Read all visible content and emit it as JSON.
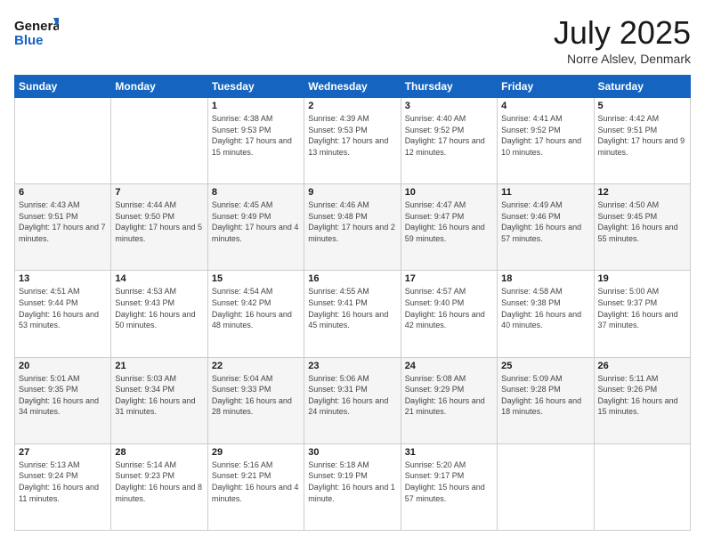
{
  "logo": {
    "line1": "General",
    "line2": "Blue"
  },
  "title": "July 2025",
  "location": "Norre Alslev, Denmark",
  "days_of_week": [
    "Sunday",
    "Monday",
    "Tuesday",
    "Wednesday",
    "Thursday",
    "Friday",
    "Saturday"
  ],
  "weeks": [
    [
      {
        "day": "",
        "info": ""
      },
      {
        "day": "",
        "info": ""
      },
      {
        "day": "1",
        "info": "Sunrise: 4:38 AM\nSunset: 9:53 PM\nDaylight: 17 hours and 15 minutes."
      },
      {
        "day": "2",
        "info": "Sunrise: 4:39 AM\nSunset: 9:53 PM\nDaylight: 17 hours and 13 minutes."
      },
      {
        "day": "3",
        "info": "Sunrise: 4:40 AM\nSunset: 9:52 PM\nDaylight: 17 hours and 12 minutes."
      },
      {
        "day": "4",
        "info": "Sunrise: 4:41 AM\nSunset: 9:52 PM\nDaylight: 17 hours and 10 minutes."
      },
      {
        "day": "5",
        "info": "Sunrise: 4:42 AM\nSunset: 9:51 PM\nDaylight: 17 hours and 9 minutes."
      }
    ],
    [
      {
        "day": "6",
        "info": "Sunrise: 4:43 AM\nSunset: 9:51 PM\nDaylight: 17 hours and 7 minutes."
      },
      {
        "day": "7",
        "info": "Sunrise: 4:44 AM\nSunset: 9:50 PM\nDaylight: 17 hours and 5 minutes."
      },
      {
        "day": "8",
        "info": "Sunrise: 4:45 AM\nSunset: 9:49 PM\nDaylight: 17 hours and 4 minutes."
      },
      {
        "day": "9",
        "info": "Sunrise: 4:46 AM\nSunset: 9:48 PM\nDaylight: 17 hours and 2 minutes."
      },
      {
        "day": "10",
        "info": "Sunrise: 4:47 AM\nSunset: 9:47 PM\nDaylight: 16 hours and 59 minutes."
      },
      {
        "day": "11",
        "info": "Sunrise: 4:49 AM\nSunset: 9:46 PM\nDaylight: 16 hours and 57 minutes."
      },
      {
        "day": "12",
        "info": "Sunrise: 4:50 AM\nSunset: 9:45 PM\nDaylight: 16 hours and 55 minutes."
      }
    ],
    [
      {
        "day": "13",
        "info": "Sunrise: 4:51 AM\nSunset: 9:44 PM\nDaylight: 16 hours and 53 minutes."
      },
      {
        "day": "14",
        "info": "Sunrise: 4:53 AM\nSunset: 9:43 PM\nDaylight: 16 hours and 50 minutes."
      },
      {
        "day": "15",
        "info": "Sunrise: 4:54 AM\nSunset: 9:42 PM\nDaylight: 16 hours and 48 minutes."
      },
      {
        "day": "16",
        "info": "Sunrise: 4:55 AM\nSunset: 9:41 PM\nDaylight: 16 hours and 45 minutes."
      },
      {
        "day": "17",
        "info": "Sunrise: 4:57 AM\nSunset: 9:40 PM\nDaylight: 16 hours and 42 minutes."
      },
      {
        "day": "18",
        "info": "Sunrise: 4:58 AM\nSunset: 9:38 PM\nDaylight: 16 hours and 40 minutes."
      },
      {
        "day": "19",
        "info": "Sunrise: 5:00 AM\nSunset: 9:37 PM\nDaylight: 16 hours and 37 minutes."
      }
    ],
    [
      {
        "day": "20",
        "info": "Sunrise: 5:01 AM\nSunset: 9:35 PM\nDaylight: 16 hours and 34 minutes."
      },
      {
        "day": "21",
        "info": "Sunrise: 5:03 AM\nSunset: 9:34 PM\nDaylight: 16 hours and 31 minutes."
      },
      {
        "day": "22",
        "info": "Sunrise: 5:04 AM\nSunset: 9:33 PM\nDaylight: 16 hours and 28 minutes."
      },
      {
        "day": "23",
        "info": "Sunrise: 5:06 AM\nSunset: 9:31 PM\nDaylight: 16 hours and 24 minutes."
      },
      {
        "day": "24",
        "info": "Sunrise: 5:08 AM\nSunset: 9:29 PM\nDaylight: 16 hours and 21 minutes."
      },
      {
        "day": "25",
        "info": "Sunrise: 5:09 AM\nSunset: 9:28 PM\nDaylight: 16 hours and 18 minutes."
      },
      {
        "day": "26",
        "info": "Sunrise: 5:11 AM\nSunset: 9:26 PM\nDaylight: 16 hours and 15 minutes."
      }
    ],
    [
      {
        "day": "27",
        "info": "Sunrise: 5:13 AM\nSunset: 9:24 PM\nDaylight: 16 hours and 11 minutes."
      },
      {
        "day": "28",
        "info": "Sunrise: 5:14 AM\nSunset: 9:23 PM\nDaylight: 16 hours and 8 minutes."
      },
      {
        "day": "29",
        "info": "Sunrise: 5:16 AM\nSunset: 9:21 PM\nDaylight: 16 hours and 4 minutes."
      },
      {
        "day": "30",
        "info": "Sunrise: 5:18 AM\nSunset: 9:19 PM\nDaylight: 16 hours and 1 minute."
      },
      {
        "day": "31",
        "info": "Sunrise: 5:20 AM\nSunset: 9:17 PM\nDaylight: 15 hours and 57 minutes."
      },
      {
        "day": "",
        "info": ""
      },
      {
        "day": "",
        "info": ""
      }
    ]
  ]
}
